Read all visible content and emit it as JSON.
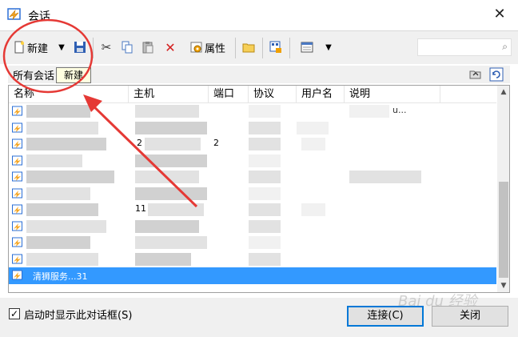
{
  "window": {
    "title": "会话"
  },
  "toolbar": {
    "new_label": "新建",
    "properties_label": "属性",
    "search_placeholder": ""
  },
  "tooltip": {
    "text": "新建"
  },
  "pathbar": {
    "text": "所有会话"
  },
  "list": {
    "columns": [
      "名称",
      "主机",
      "端口",
      "协议",
      "用户名",
      "说明"
    ],
    "visible_fragments": {
      "row1_desc": "u...",
      "row3_host": "2",
      "row3_port": "2",
      "row7_host": "11",
      "selected_row": "清狮服务...31"
    }
  },
  "footer": {
    "startup_checkbox_label": "启动时显示此对话框(S)",
    "checked": true,
    "connect_label": "连接(C)",
    "close_label": "关闭"
  },
  "watermark": "Bai du 经验",
  "colors": {
    "selection": "#3399ff",
    "annotation_red": "#e53935",
    "default_button_border": "#0078d7"
  }
}
